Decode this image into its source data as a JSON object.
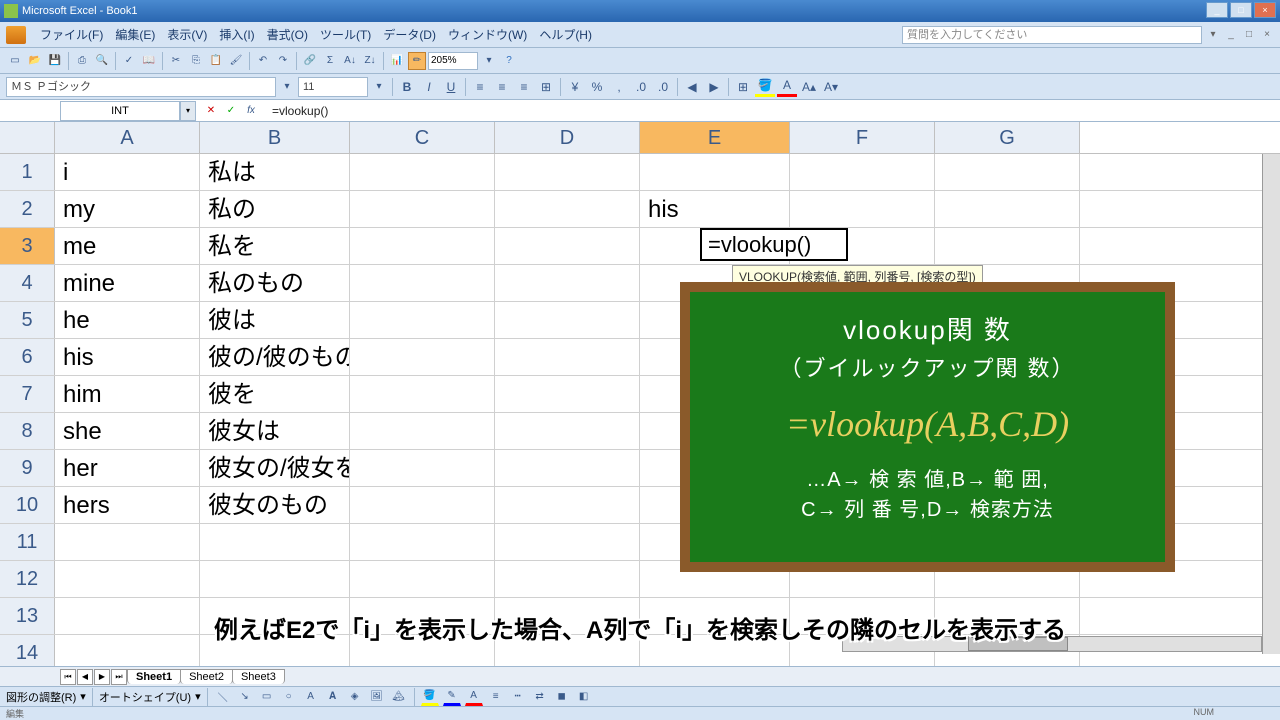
{
  "app": {
    "title": "Microsoft Excel - Book1"
  },
  "menu": {
    "items": [
      "ファイル(F)",
      "編集(E)",
      "表示(V)",
      "挿入(I)",
      "書式(O)",
      "ツール(T)",
      "データ(D)",
      "ウィンドウ(W)",
      "ヘルプ(H)"
    ],
    "help_placeholder": "質問を入力してください"
  },
  "format": {
    "font_name": "ＭＳ Ｐゴシック",
    "font_size": "11",
    "bold": "B",
    "italic": "I",
    "underline": "U"
  },
  "toolbar": {
    "zoom": "205%"
  },
  "formula_bar": {
    "name_box": "INT",
    "formula": "=vlookup()"
  },
  "columns": [
    "A",
    "B",
    "C",
    "D",
    "E",
    "F",
    "G"
  ],
  "active_col_index": 4,
  "active_row_index": 2,
  "rows": [
    {
      "n": "1",
      "A": "i",
      "B": "私は",
      "E": ""
    },
    {
      "n": "2",
      "A": "my",
      "B": "私の",
      "E": "his"
    },
    {
      "n": "3",
      "A": "me",
      "B": "私を",
      "E": ""
    },
    {
      "n": "4",
      "A": "mine",
      "B": "私のもの",
      "E": ""
    },
    {
      "n": "5",
      "A": "he",
      "B": "彼は",
      "E": ""
    },
    {
      "n": "6",
      "A": "his",
      "B": "彼の/彼のもの",
      "E": ""
    },
    {
      "n": "7",
      "A": "him",
      "B": "彼を",
      "E": ""
    },
    {
      "n": "8",
      "A": "she",
      "B": "彼女は",
      "E": ""
    },
    {
      "n": "9",
      "A": "her",
      "B": "彼女の/彼女を",
      "E": ""
    },
    {
      "n": "10",
      "A": "hers",
      "B": "彼女のもの",
      "E": ""
    },
    {
      "n": "11",
      "A": "",
      "B": "",
      "E": ""
    },
    {
      "n": "12",
      "A": "",
      "B": "",
      "E": ""
    },
    {
      "n": "13",
      "A": "",
      "B": "",
      "E": ""
    },
    {
      "n": "14",
      "A": "",
      "B": "",
      "E": ""
    }
  ],
  "cell_edit": {
    "value": "=vlookup()"
  },
  "fn_tooltip": "VLOOKUP(検索値, 範囲, 列番号, [検索の型])",
  "chalkboard": {
    "title": "vlookup関 数",
    "subtitle": "（ブイルックアップ関 数）",
    "formula": "=vlookup(A,B,C,D)",
    "desc1": "…A→ 検 索 値,B→ 範 囲,",
    "desc2": "C→ 列 番 号,D→ 検索方法"
  },
  "subtitle": "例えばE2で「i」を表示した場合、A列で「i」を検索しその隣のセルを表示する",
  "sheets": [
    "Sheet1",
    "Sheet2",
    "Sheet3"
  ],
  "drawbar": {
    "shape_menu": "図形の調整(R)",
    "autoshape": "オートシェイプ(U)"
  },
  "status": {
    "mode": "編集",
    "num": "NUM"
  }
}
